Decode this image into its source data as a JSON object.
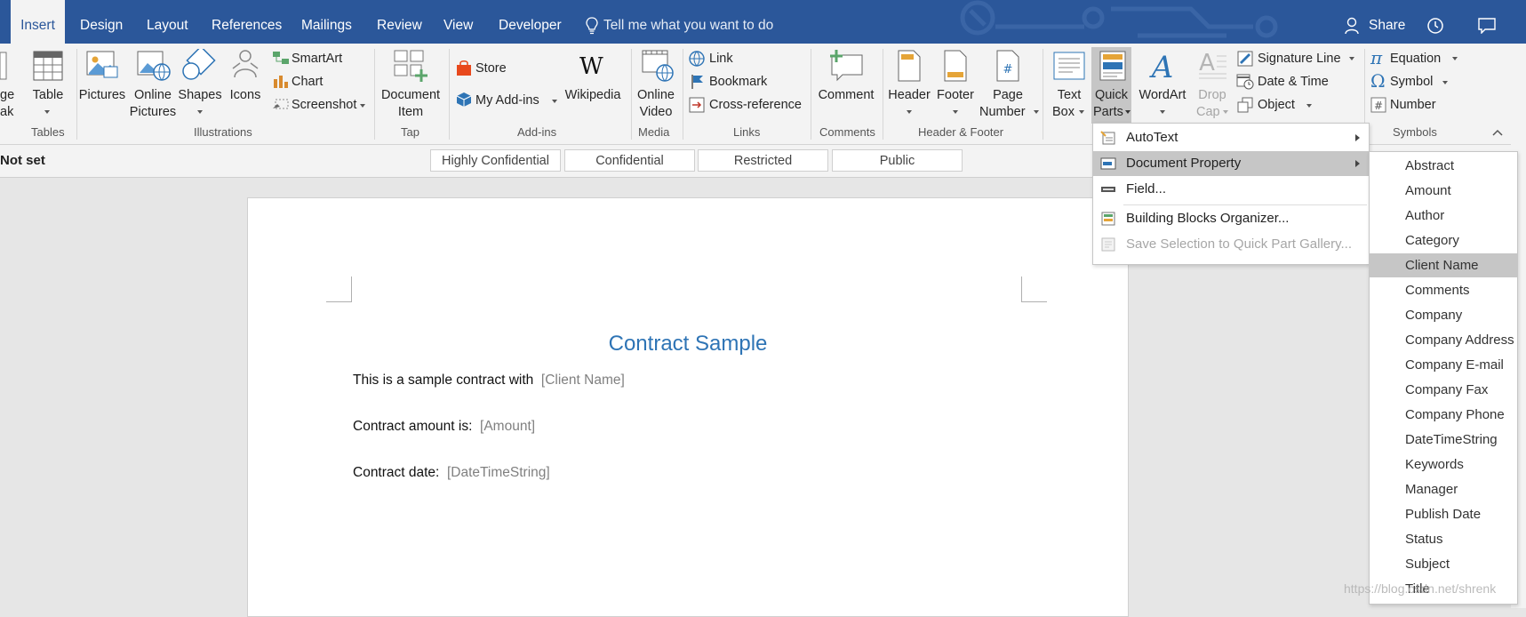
{
  "tabs": {
    "insert": "Insert",
    "design": "Design",
    "layout": "Layout",
    "references": "References",
    "mailings": "Mailings",
    "review": "Review",
    "view": "View",
    "developer": "Developer"
  },
  "tell_me": "Tell me what you want to do",
  "share": "Share",
  "ribbon": {
    "page_break_1": "ge",
    "page_break_2": "ak",
    "table": "Table",
    "tables_group": "Tables",
    "pictures": "Pictures",
    "online_pictures_1": "Online",
    "online_pictures_2": "Pictures",
    "shapes": "Shapes",
    "icons": "Icons",
    "smartart": "SmartArt",
    "chart": "Chart",
    "screenshot": "Screenshot",
    "illustrations_group": "Illustrations",
    "document_item_1": "Document",
    "document_item_2": "Item",
    "tap_group": "Tap",
    "store": "Store",
    "my_addins": "My Add-ins",
    "wikipedia": "Wikipedia",
    "addins_group": "Add-ins",
    "online_video_1": "Online",
    "online_video_2": "Video",
    "media_group": "Media",
    "link": "Link",
    "bookmark": "Bookmark",
    "cross_reference": "Cross-reference",
    "links_group": "Links",
    "comment": "Comment",
    "comments_group": "Comments",
    "header": "Header",
    "footer": "Footer",
    "page_number_1": "Page",
    "page_number_2": "Number",
    "header_footer_group": "Header & Footer",
    "text_box_1": "Text",
    "text_box_2": "Box",
    "quick_parts_1": "Quick",
    "quick_parts_2": "Parts",
    "wordart": "WordArt",
    "drop_cap_1": "Drop",
    "drop_cap_2": "Cap",
    "signature_line": "Signature Line",
    "date_time": "Date & Time",
    "object": "Object",
    "equation": "Equation",
    "symbol": "Symbol",
    "number": "Number",
    "symbols_group": "Symbols"
  },
  "classification": {
    "status": "Not set",
    "buttons": [
      "Highly Confidential",
      "Confidential",
      "Restricted",
      "Public"
    ]
  },
  "document": {
    "title": "Contract Sample",
    "line1_text": "This is a sample contract with",
    "line1_field": "[Client Name]",
    "line2_text": "Contract amount is:",
    "line2_field": "[Amount]",
    "line3_text": "Contract date:",
    "line3_field": "[DateTimeString]"
  },
  "quick_parts_menu": {
    "items": [
      "AutoText",
      "Document Property",
      "Field...",
      "Building Blocks Organizer...",
      "Save Selection to Quick Part Gallery..."
    ]
  },
  "document_property_menu": {
    "items": [
      "Abstract",
      "Amount",
      "Author",
      "Category",
      "Client Name",
      "Comments",
      "Company",
      "Company Address",
      "Company E-mail",
      "Company Fax",
      "Company Phone",
      "DateTimeString",
      "Keywords",
      "Manager",
      "Publish Date",
      "Status",
      "Subject",
      "Title"
    ],
    "selected": "Client Name"
  },
  "watermark": "https://blog.csdn.net/shrenk",
  "colors": {
    "accent": "#2b579a",
    "title_blue": "#2e74b5",
    "menu_highlight": "#c6c6c6"
  }
}
